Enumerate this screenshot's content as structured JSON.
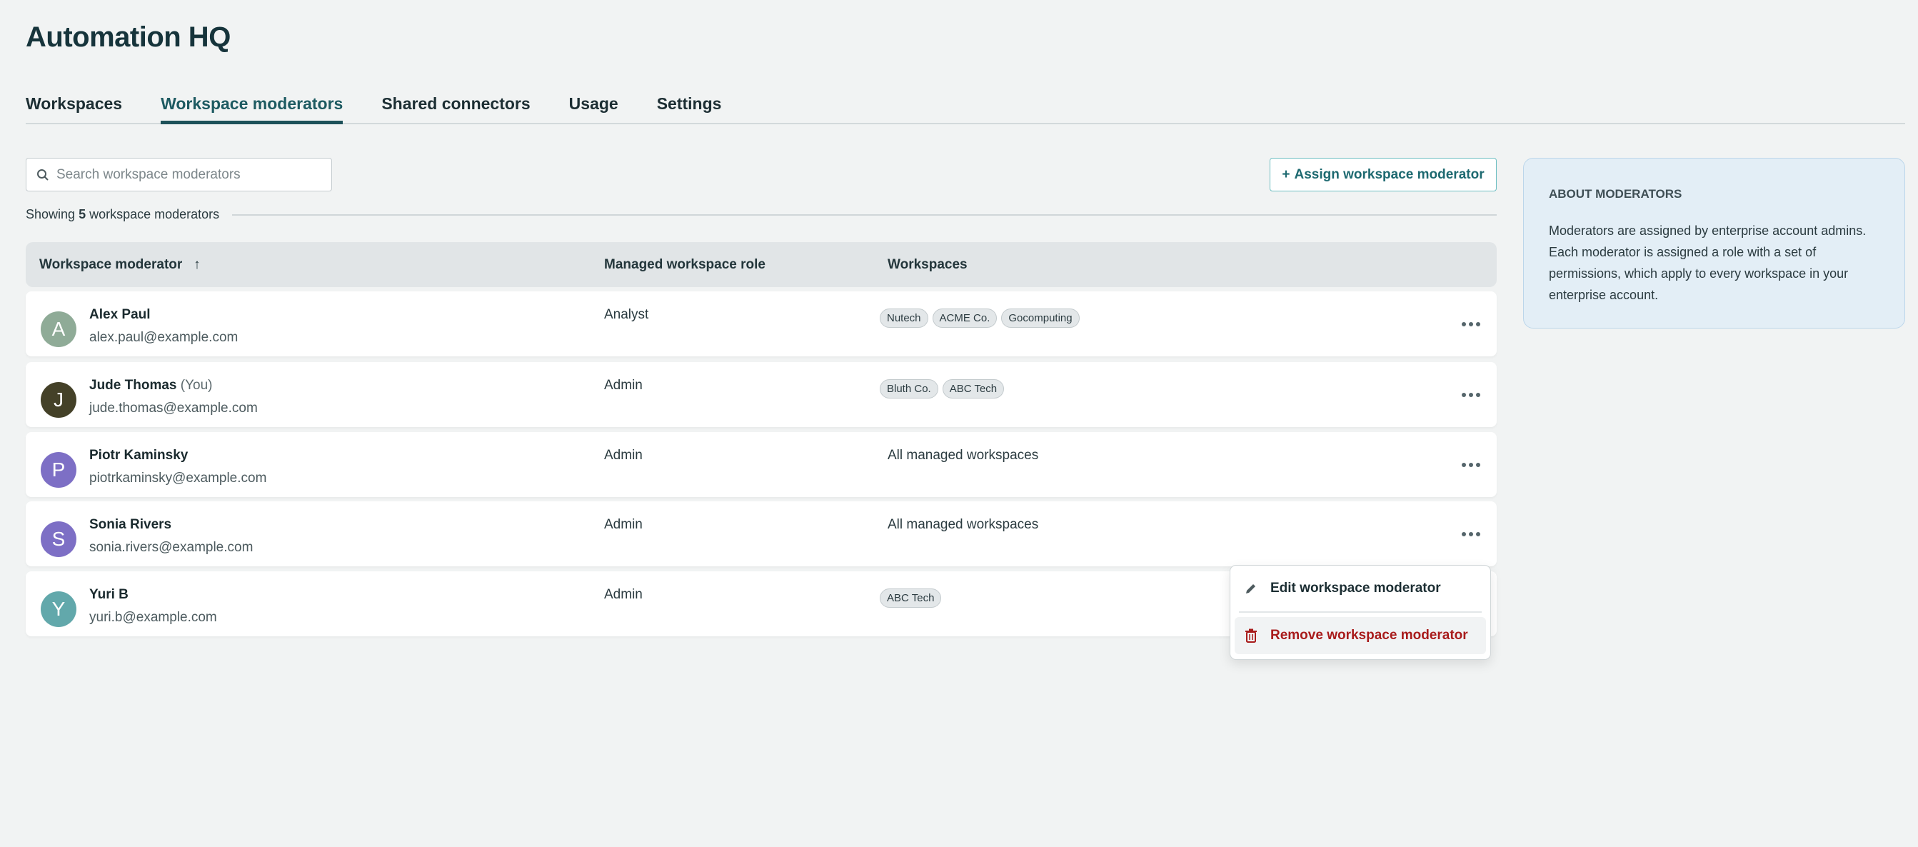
{
  "app": {
    "title": "Automation HQ"
  },
  "tabs": [
    {
      "label": "Workspaces"
    },
    {
      "label": "Workspace moderators",
      "active": true
    },
    {
      "label": "Shared connectors"
    },
    {
      "label": "Usage"
    },
    {
      "label": "Settings"
    }
  ],
  "search": {
    "placeholder": "Search workspace moderators",
    "value": ""
  },
  "assign_button": {
    "icon": "plus-icon",
    "plus": "+",
    "label": "Assign workspace moderator"
  },
  "summary": {
    "prefix": "Showing",
    "count": "5",
    "suffix": "workspace moderators"
  },
  "table": {
    "columns": {
      "moderator": "Workspace moderator",
      "sort_arrow": "↑",
      "role": "Managed workspace role",
      "workspaces": "Workspaces"
    },
    "rows": [
      {
        "initial": "A",
        "avatar_color": "#8fab97",
        "name": "Alex Paul",
        "you": "",
        "email": "alex.paul@example.com",
        "role": "Analyst",
        "workspaces": [
          "Nutech",
          "ACME Co.",
          "Gocomputing"
        ],
        "workspaces_text": ""
      },
      {
        "initial": "J",
        "avatar_color": "#444128",
        "name": "Jude Thomas",
        "you": "(You)",
        "email": "jude.thomas@example.com",
        "role": "Admin",
        "workspaces": [
          "Bluth Co.",
          "ABC Tech"
        ],
        "workspaces_text": ""
      },
      {
        "initial": "P",
        "avatar_color": "#7d6fc5",
        "name": "Piotr Kaminsky",
        "you": "",
        "email": "piotrkaminsky@example.com",
        "role": "Admin",
        "workspaces": [],
        "workspaces_text": "All managed workspaces"
      },
      {
        "initial": "S",
        "avatar_color": "#7d6fc5",
        "name": "Sonia Rivers",
        "you": "",
        "email": "sonia.rivers@example.com",
        "role": "Admin",
        "workspaces": [],
        "workspaces_text": "All managed workspaces"
      },
      {
        "initial": "Y",
        "avatar_color": "#62a8ab",
        "name": "Yuri B",
        "you": "",
        "email": "yuri.b@example.com",
        "role": "Admin",
        "workspaces": [
          "ABC Tech"
        ],
        "workspaces_text": ""
      }
    ]
  },
  "about": {
    "heading": "ABOUT MODERATORS",
    "body": "Moderators are assigned by enterprise account admins. Each moderator is assigned a role with a set of permissions, which apply to every workspace in your enterprise account."
  },
  "context_menu": {
    "edit": {
      "icon": "pencil-icon",
      "label": "Edit workspace moderator"
    },
    "remove": {
      "icon": "trash-icon",
      "label": "Remove workspace moderator",
      "color": "#a81b1b"
    }
  }
}
